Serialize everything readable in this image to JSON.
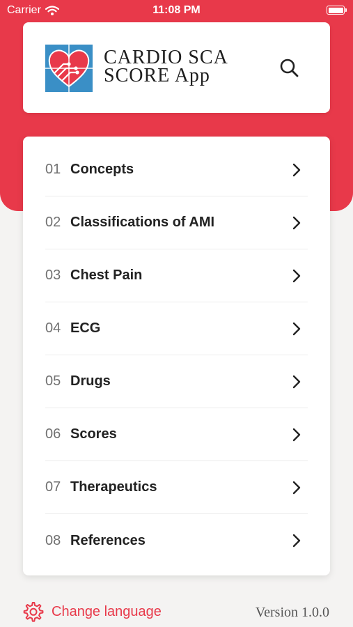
{
  "status_bar": {
    "carrier": "Carrier",
    "time": "11:08 PM"
  },
  "header": {
    "title_line1": "CARDIO SCA",
    "title_line2": "SCORE App"
  },
  "menu": [
    {
      "num": "01",
      "label": "Concepts"
    },
    {
      "num": "02",
      "label": "Classifications of AMI"
    },
    {
      "num": "03",
      "label": "Chest Pain"
    },
    {
      "num": "04",
      "label": "ECG"
    },
    {
      "num": "05",
      "label": "Drugs"
    },
    {
      "num": "06",
      "label": "Scores"
    },
    {
      "num": "07",
      "label": "Therapeutics"
    },
    {
      "num": "08",
      "label": "References"
    }
  ],
  "footer": {
    "change_language": "Change language",
    "version": "Version 1.0.0"
  },
  "colors": {
    "accent": "#e8394a",
    "logo_blue": "#3a8fc6",
    "background": "#f4f3f2"
  }
}
